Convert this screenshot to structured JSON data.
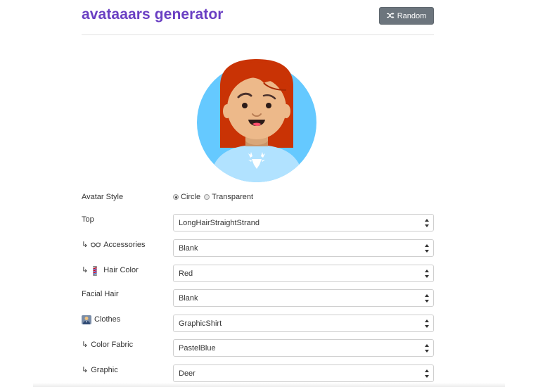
{
  "header": {
    "title": "avataaars generator",
    "random_label": "Random"
  },
  "avatar": {
    "background_color": "#65C9FF",
    "hair_color": "#C93305",
    "skin_color": "#EDB98A",
    "shirt_color": "#B1E2FF"
  },
  "form": {
    "avatar_style": {
      "label": "Avatar Style",
      "options": [
        "Circle",
        "Transparent"
      ],
      "selected": "Circle"
    },
    "top": {
      "label": "Top",
      "value": "LongHairStraightStrand"
    },
    "accessories": {
      "label": "Accessories",
      "value": "Blank"
    },
    "hair_color": {
      "label": "Hair Color",
      "value": "Red"
    },
    "facial_hair": {
      "label": "Facial Hair",
      "value": "Blank"
    },
    "clothes": {
      "label": "Clothes",
      "value": "GraphicShirt"
    },
    "color_fabric": {
      "label": "Color Fabric",
      "value": "PastelBlue"
    },
    "graphic": {
      "label": "Graphic",
      "value": "Deer"
    }
  },
  "colors": {
    "title": "#6A3FC3",
    "button": "#6C757D"
  }
}
